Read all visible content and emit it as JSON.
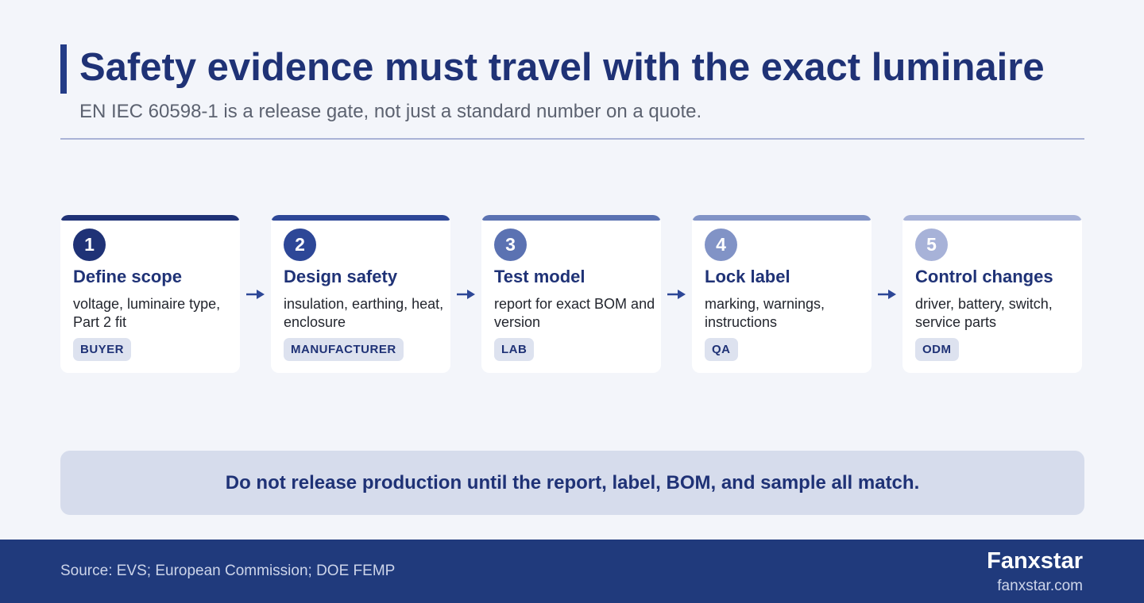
{
  "header": {
    "title": "Safety evidence must travel with the exact luminaire",
    "subtitle": "EN IEC 60598-1 is a release gate, not just a standard number on a quote."
  },
  "steps": [
    {
      "number": "1",
      "title": "Define scope",
      "description": "voltage, luminaire type, Part 2 fit",
      "owner": "BUYER",
      "color": "#1f3276"
    },
    {
      "number": "2",
      "title": "Design safety",
      "description": "insulation, earthing, heat, enclosure",
      "owner": "MANUFACTURER",
      "color": "#2d4797"
    },
    {
      "number": "3",
      "title": "Test model",
      "description": "report for exact BOM and version",
      "owner": "LAB",
      "color": "#5b72b2"
    },
    {
      "number": "4",
      "title": "Lock label",
      "description": "marking, warnings, instructions",
      "owner": "QA",
      "color": "#8193c6"
    },
    {
      "number": "5",
      "title": "Control changes",
      "description": "driver, battery, switch, service parts",
      "owner": "ODM",
      "color": "#a7b2d8"
    }
  ],
  "callout": "Do not release production until the report, label, BOM, and sample all match.",
  "footer": {
    "source": "Source: EVS; European Commission; DOE FEMP",
    "brand": "Fanxstar",
    "site": "fanxstar.com"
  },
  "colors": {
    "accent": "#1f3276",
    "arrow": "#2d4797",
    "background": "#f3f5fa",
    "footer": "#203a7c"
  }
}
